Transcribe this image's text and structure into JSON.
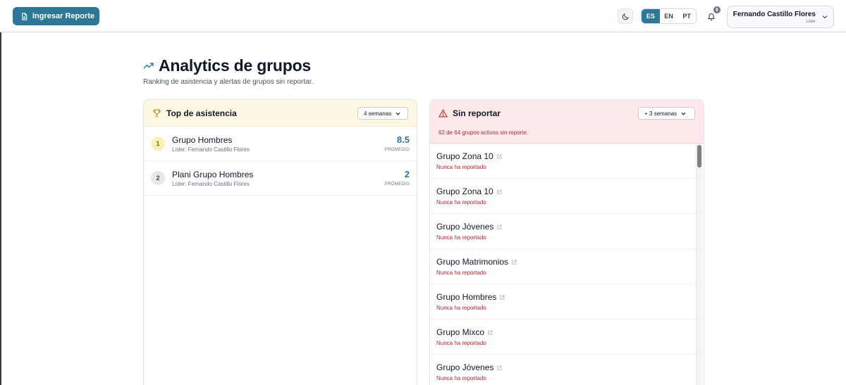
{
  "topbar": {
    "report_button_label": "Ingresar Reporte",
    "languages": [
      "ES",
      "EN",
      "PT"
    ],
    "active_language": "ES",
    "notification_count": "6",
    "user_name": "Fernando Castillo Flores",
    "user_role": "Líder"
  },
  "header": {
    "title": "Analytics de grupos",
    "subtitle": "Ranking de asistencia y alertas de grupos sin reportar."
  },
  "top_attendance": {
    "title": "Top de asistencia",
    "select_value": "4 semanas",
    "rows": [
      {
        "rank": "1",
        "name": "Grupo Hombres",
        "leader": "Líder: Fernando Castillo Flores",
        "value": "8.5",
        "value_label": "PROMEDIO"
      },
      {
        "rank": "2",
        "name": "Plani Grupo Hombres",
        "leader": "Líder: Fernando Castillo Flores",
        "value": "2",
        "value_label": "PROMEDIO"
      }
    ]
  },
  "not_reporting": {
    "title": "Sin reportar",
    "select_value": "+ 3 semanas",
    "summary": "62 de 64 grupos activos sin reporte.",
    "rows": [
      {
        "name": "Grupo Zona 10",
        "status": "Nunca ha reportado"
      },
      {
        "name": "Grupo Zona 10",
        "status": "Nunca ha reportado"
      },
      {
        "name": "Grupo Jóvenes",
        "status": "Nunca ha reportado"
      },
      {
        "name": "Grupo Matrimonios",
        "status": "Nunca ha reportado"
      },
      {
        "name": "Grupo Hombres",
        "status": "Nunca ha reportado"
      },
      {
        "name": "Grupo Mixco",
        "status": "Nunca ha reportado"
      },
      {
        "name": "Grupo Jóvenes",
        "status": "Nunca ha reportado"
      }
    ]
  },
  "colors": {
    "accent": "#2f7797",
    "alert_text": "#b4262f",
    "alert_bg": "#fde9ea",
    "highlight_bg": "#fdf8e3"
  }
}
